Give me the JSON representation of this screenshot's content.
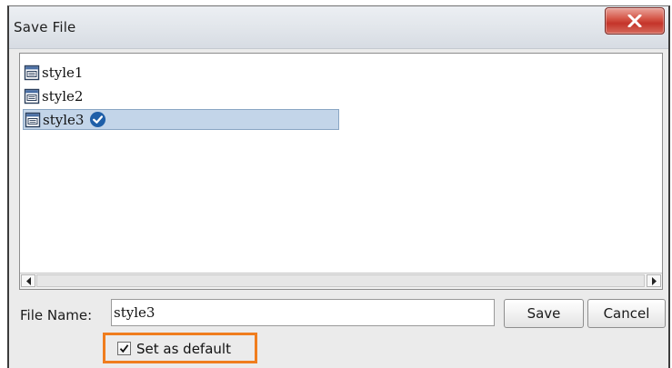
{
  "window": {
    "title": "Save File",
    "close_icon": "close-icon"
  },
  "file_list": {
    "items": [
      {
        "name": "style1",
        "icon": "style-file-icon",
        "selected": false
      },
      {
        "name": "style2",
        "icon": "style-file-icon",
        "selected": false
      },
      {
        "name": "style3",
        "icon": "style-file-icon",
        "selected": true,
        "badge": "checkmark-badge-icon"
      }
    ]
  },
  "form": {
    "file_name_label": "File Name:",
    "file_name_value": "style3",
    "save_label": "Save",
    "cancel_label": "Cancel",
    "set_default_label": "Set as default",
    "set_default_checked": true
  },
  "colors": {
    "highlight_border": "#f07d1e",
    "selection_bg": "#c3d5e9",
    "badge": "#1f5fa8",
    "close_button": "#c4342a"
  }
}
